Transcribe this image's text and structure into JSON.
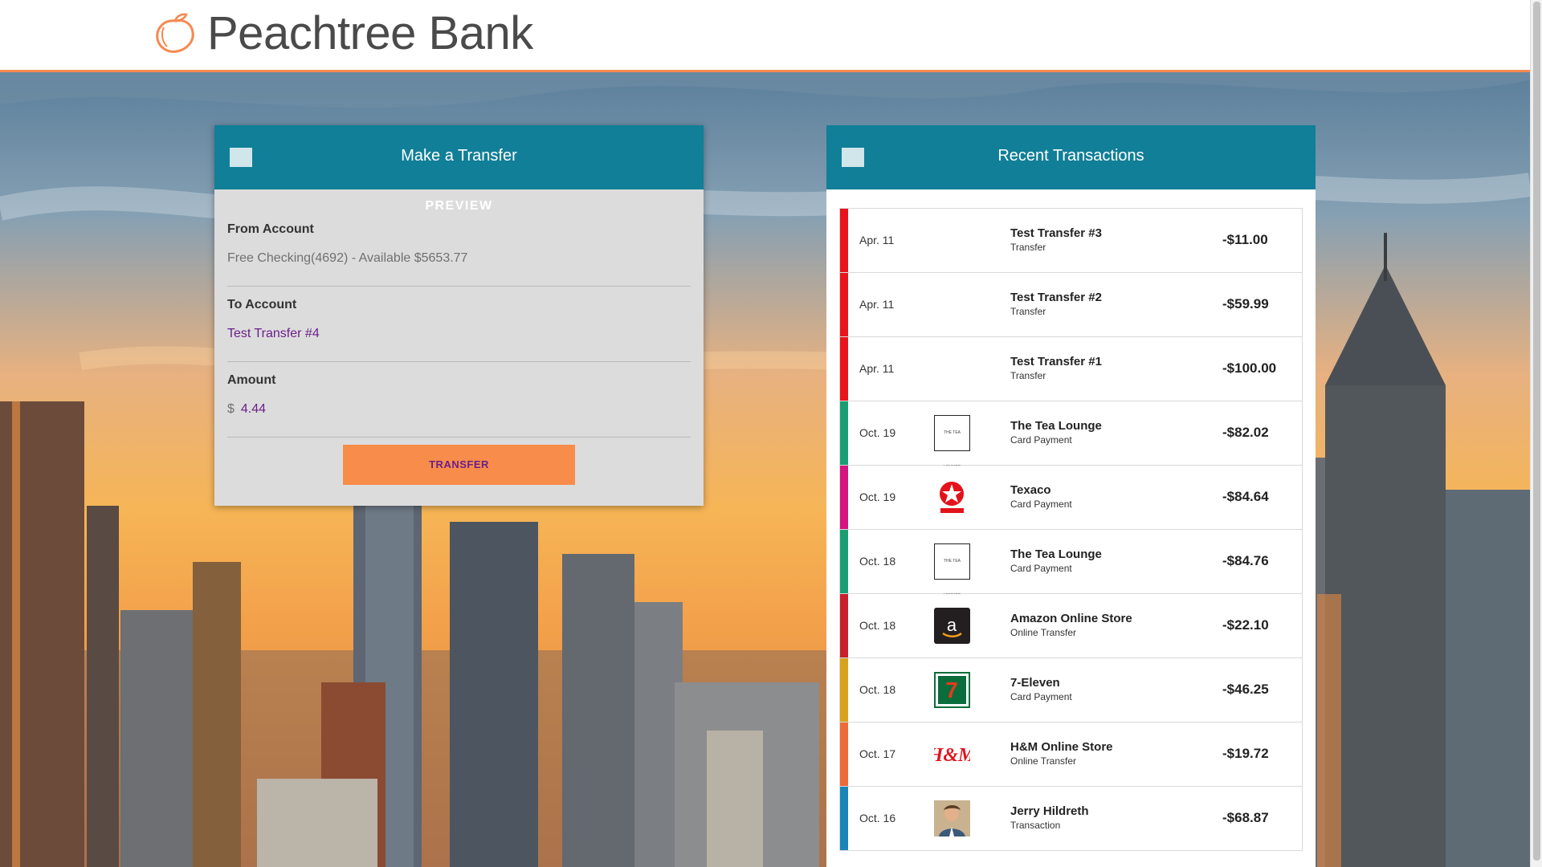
{
  "brand": {
    "name": "Peachtree Bank",
    "accent": "#f6894f",
    "teal": "#117f98"
  },
  "transfer": {
    "title": "Make a Transfer",
    "preview_label": "PREVIEW",
    "from_label": "From Account",
    "from_value": "Free Checking(4692) - Available $5653.77",
    "to_label": "To Account",
    "to_value": "Test Transfer #4",
    "amount_label": "Amount",
    "amount_currency": "$",
    "amount_value": "4.44",
    "button_label": "TRANSFER"
  },
  "transactions": {
    "title": "Recent Transactions",
    "items": [
      {
        "date": "Apr. 11",
        "name": "Test Transfer #3",
        "type": "Transfer",
        "amount": "-$11.00",
        "color": "#e8141c",
        "logo": "none"
      },
      {
        "date": "Apr. 11",
        "name": "Test Transfer #2",
        "type": "Transfer",
        "amount": "-$59.99",
        "color": "#e8141c",
        "logo": "none"
      },
      {
        "date": "Apr. 11",
        "name": "Test Transfer #1",
        "type": "Transfer",
        "amount": "-$100.00",
        "color": "#e8141c",
        "logo": "none"
      },
      {
        "date": "Oct. 19",
        "name": "The Tea Lounge",
        "type": "Card Payment",
        "amount": "-$82.02",
        "color": "#1b9d74",
        "logo": "tea-lounge"
      },
      {
        "date": "Oct. 19",
        "name": "Texaco",
        "type": "Card Payment",
        "amount": "-$84.64",
        "color": "#d4147f",
        "logo": "texaco"
      },
      {
        "date": "Oct. 18",
        "name": "The Tea Lounge",
        "type": "Card Payment",
        "amount": "-$84.76",
        "color": "#1b9d74",
        "logo": "tea-lounge"
      },
      {
        "date": "Oct. 18",
        "name": "Amazon Online Store",
        "type": "Online Transfer",
        "amount": "-$22.10",
        "color": "#c8202c",
        "logo": "amazon"
      },
      {
        "date": "Oct. 18",
        "name": "7-Eleven",
        "type": "Card Payment",
        "amount": "-$46.25",
        "color": "#d7a21c",
        "logo": "seven-eleven"
      },
      {
        "date": "Oct. 17",
        "name": "H&M Online Store",
        "type": "Online Transfer",
        "amount": "-$19.72",
        "color": "#ee6a3a",
        "logo": "hm"
      },
      {
        "date": "Oct. 16",
        "name": "Jerry Hildreth",
        "type": "Transaction",
        "amount": "-$68.87",
        "color": "#1a86b8",
        "logo": "person-photo"
      }
    ]
  }
}
